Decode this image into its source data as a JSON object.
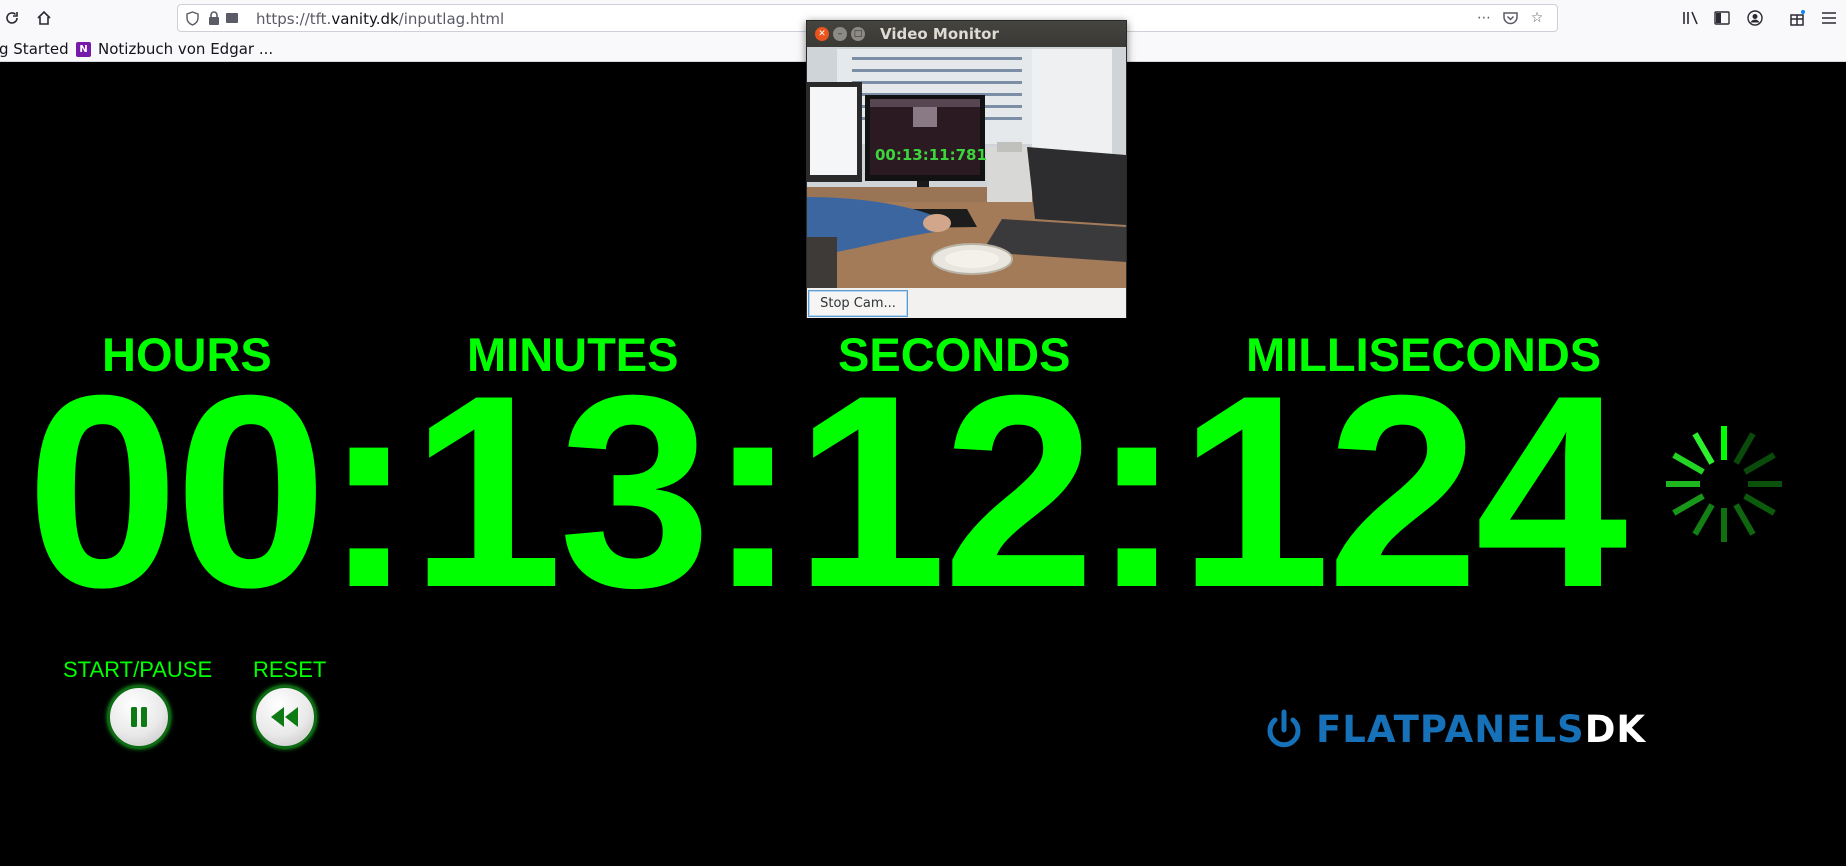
{
  "browser": {
    "url_prefix": "https://tft.",
    "url_domain": "vanity.dk",
    "url_path": "/inputlag.html",
    "bookmarks": [
      {
        "label": "g Started"
      },
      {
        "label": "Notizbuch von Edgar ..."
      }
    ]
  },
  "timer": {
    "units": {
      "hours": "HOURS",
      "minutes": "MINUTES",
      "seconds": "SECONDS",
      "milliseconds": "MILLISECONDS"
    },
    "display": "00:13:12:124",
    "color": "#00ff00"
  },
  "controls": {
    "start_pause_label": "START/PAUSE",
    "reset_label": "RESET"
  },
  "logo": {
    "part1": "FLATPANELS",
    "part2": "DK",
    "color": "#1671b8"
  },
  "video_monitor": {
    "title": "Video Monitor",
    "stop_button": "Stop Cam...",
    "captured_time": "00:13:11:781"
  }
}
